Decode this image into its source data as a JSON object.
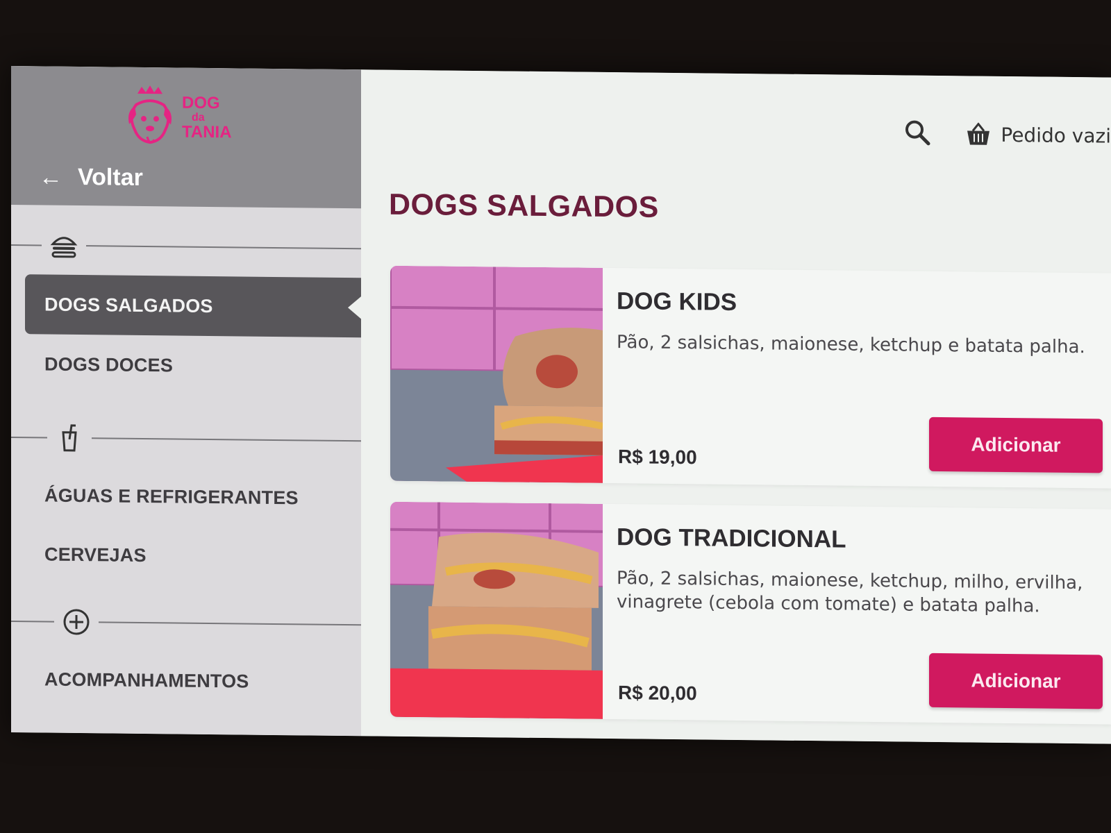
{
  "brand": {
    "logo_line1": "DOG",
    "logo_line2": "da",
    "logo_line3": "TANIA",
    "accent": "#e52483"
  },
  "sidebar": {
    "back_label": "Voltar",
    "groups": [
      {
        "icon": "burger-icon",
        "items": [
          {
            "label": "DOGS SALGADOS",
            "active": true
          },
          {
            "label": "DOGS DOCES",
            "active": false
          }
        ]
      },
      {
        "icon": "drink-icon",
        "items": [
          {
            "label": "ÁGUAS E REFRIGERANTES",
            "active": false
          },
          {
            "label": "CERVEJAS",
            "active": false
          }
        ]
      },
      {
        "icon": "plus-circle-icon",
        "items": [
          {
            "label": "ACOMPANHAMENTOS",
            "active": false
          }
        ]
      }
    ]
  },
  "header": {
    "order_status": "Pedido vazi"
  },
  "main": {
    "title": "DOGS SALGADOS",
    "products": [
      {
        "name": "DOG KIDS",
        "description": "Pão, 2 salsichas, maionese, ketchup e batata palha.",
        "price": "R$ 19,00",
        "button_label": "Adicionar"
      },
      {
        "name": "DOG TRADICIONAL",
        "description": "Pão, 2 salsichas, maionese, ketchup, milho, ervilha, vinagrete (cebola com tomate) e batata palha.",
        "price": "R$ 20,00",
        "button_label": "Adicionar"
      }
    ]
  },
  "colors": {
    "button": "#d0195f",
    "title": "#6a1d3b",
    "sidebar_active": "#58565a"
  }
}
